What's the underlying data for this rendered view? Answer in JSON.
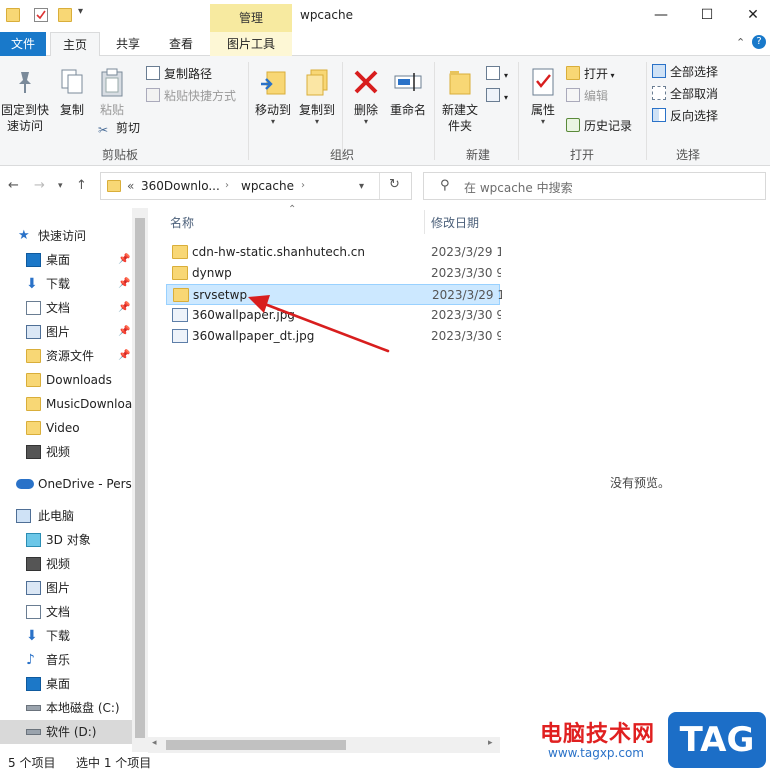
{
  "window": {
    "title": "wpcache",
    "context_tab": "管理",
    "minimize": "—",
    "maximize": "☐",
    "close": "✕"
  },
  "ribbon_tabs": [
    {
      "label": "文件"
    },
    {
      "label": "主页"
    },
    {
      "label": "共享"
    },
    {
      "label": "查看"
    },
    {
      "label": "图片工具"
    }
  ],
  "ribbon": {
    "clipboard": {
      "label": "剪贴板",
      "pin_quick": "固定到快速访问",
      "copy": "复制",
      "paste": "粘贴",
      "copy_path": "复制路径",
      "paste_shortcut": "粘贴快捷方式",
      "cut": "剪切"
    },
    "organize": {
      "label": "组织",
      "move_to": "移动到",
      "copy_to": "复制到",
      "delete": "删除",
      "rename": "重命名"
    },
    "new": {
      "label": "新建",
      "new_folder": "新建文件夹"
    },
    "open": {
      "label": "打开",
      "properties": "属性",
      "open": "打开",
      "edit": "编辑",
      "history": "历史记录"
    },
    "select": {
      "label": "选择",
      "select_all": "全部选择",
      "select_none": "全部取消",
      "invert": "反向选择"
    }
  },
  "address": {
    "prefix": "«",
    "crumbs": [
      "360Downlo...",
      "wpcache"
    ],
    "search_placeholder": "在 wpcache 中搜索"
  },
  "nav": {
    "quick_access": "快速访问",
    "items": [
      {
        "label": "桌面",
        "pinned": true
      },
      {
        "label": "下载",
        "pinned": true
      },
      {
        "label": "文档",
        "pinned": true
      },
      {
        "label": "图片",
        "pinned": true
      },
      {
        "label": "资源文件",
        "pinned": true
      },
      {
        "label": "Downloads"
      },
      {
        "label": "MusicDownload"
      },
      {
        "label": "Video"
      },
      {
        "label": "视频"
      }
    ],
    "onedrive": "OneDrive - Personal",
    "this_pc": "此电脑",
    "pc_items": [
      {
        "label": "3D 对象"
      },
      {
        "label": "视频"
      },
      {
        "label": "图片"
      },
      {
        "label": "文档"
      },
      {
        "label": "下载"
      },
      {
        "label": "音乐"
      },
      {
        "label": "桌面"
      },
      {
        "label": "本地磁盘 (C:)"
      },
      {
        "label": "软件 (D:)"
      }
    ]
  },
  "filelist": {
    "col_name": "名称",
    "col_date": "修改日期",
    "rows": [
      {
        "name": "cdn-hw-static.shanhutech.cn",
        "date": "2023/3/29 1",
        "type": "folder"
      },
      {
        "name": "dynwp",
        "date": "2023/3/30 9",
        "type": "folder"
      },
      {
        "name": "srvsetwp",
        "date": "2023/3/29 1",
        "type": "folder",
        "selected": true
      },
      {
        "name": "360wallpaper.jpg",
        "date": "2023/3/30 9",
        "type": "image"
      },
      {
        "name": "360wallpaper_dt.jpg",
        "date": "2023/3/30 9",
        "type": "image"
      }
    ]
  },
  "preview": {
    "empty_text": "没有预览。"
  },
  "status": {
    "count": "5 个项目",
    "selected": "选中 1 个项目"
  },
  "watermark": {
    "site_name": "电脑技术网",
    "url": "www.tagxp.com",
    "badge": "TAG"
  },
  "colors": {
    "accent": "#1979ca",
    "selection": "#cce8ff",
    "folder": "#f8d775",
    "arrow": "#d81e1e"
  }
}
